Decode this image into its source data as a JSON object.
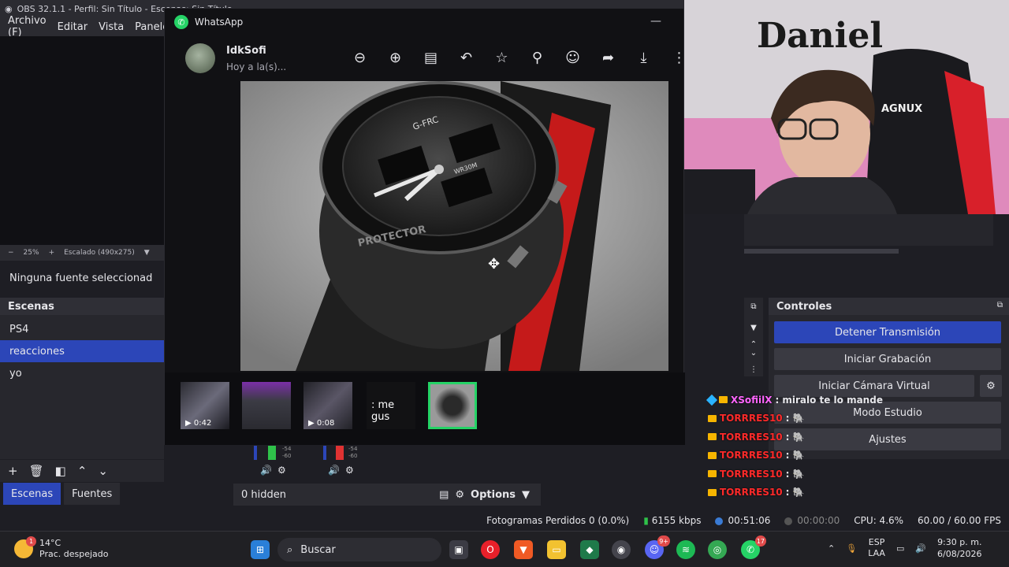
{
  "obs": {
    "title": "OBS 32.1.1 - Perfil: Sin Título - Escenas: Sin Título",
    "menu": [
      "Archivo (F)",
      "Editar",
      "Vista",
      "Panele"
    ],
    "zoom": {
      "level": "25%",
      "scaling": "Escalado (490x275)"
    },
    "no_source": "Ninguna fuente seleccionad",
    "scenes": {
      "header": "Escenas",
      "items": [
        "PS4",
        "reacciones",
        "yo"
      ],
      "selected": "reacciones"
    },
    "dock_tabs": [
      "Escenas",
      "Fuentes"
    ],
    "mixer": {
      "hidden_label": "0 hidden",
      "options_label": "Options"
    },
    "controls": {
      "header": "Controles",
      "buttons": [
        "Detener Transmisión",
        "Iniciar Grabación",
        "Iniciar Cámara Virtual",
        "Modo Estudio",
        "Ajustes"
      ]
    },
    "status": {
      "dropped": "Fotogramas Perdidos 0 (0.0%)",
      "bitrate": "6155 kbps",
      "stream_time": "00:51:06",
      "rec_time": "00:00:00",
      "cpu": "CPU: 4.6%",
      "fps": "60.00 / 60.00 FPS"
    }
  },
  "whatsapp": {
    "window_title": "WhatsApp",
    "contact_name": "IdkSofi",
    "timestamp": "Hoy a la(s)...",
    "thumbnails": [
      {
        "label": "0:42"
      },
      {
        "label": ""
      },
      {
        "label": "0:08"
      },
      {
        "label": ": me gus"
      },
      {
        "label": ""
      }
    ],
    "image_text": {
      "brand": "G-FRC",
      "depth": "WR30M",
      "bezel": "PROTECTOR"
    },
    "tool_icons": [
      "zoom-out-icon",
      "zoom-in-icon",
      "caption-icon",
      "reply-icon",
      "star-icon",
      "pin-icon",
      "react-icon",
      "forward-icon",
      "download-icon",
      "more-icon"
    ]
  },
  "webcam": {
    "wall_text": "Daniel",
    "chair_text": "AGNUX"
  },
  "chat": [
    {
      "user": "XSofiilX",
      "message": "miralo te lo mande",
      "color": "#ff66ff"
    },
    {
      "user": "TORRRES10",
      "message": "",
      "color": "#ff2a2a"
    },
    {
      "user": "TORRRES10",
      "message": "",
      "color": "#ff2a2a"
    },
    {
      "user": "TORRRES10",
      "message": "",
      "color": "#ff2a2a"
    },
    {
      "user": "TORRRES10",
      "message": "",
      "color": "#ff2a2a"
    },
    {
      "user": "TORRRES10",
      "message": "",
      "color": "#ff2a2a"
    }
  ],
  "taskbar": {
    "weather": {
      "temp": "14°C",
      "desc": "Prac. despejado",
      "badge": "1"
    },
    "search_placeholder": "Buscar",
    "badges": {
      "discord": "9+",
      "whatsapp": "17"
    },
    "lang": "ESP",
    "layout": "LAA",
    "time": "9:30 p. m.",
    "date": "6/08/2026"
  },
  "colors": {
    "accent": "#2c46b8",
    "whatsapp_green": "#25d366"
  }
}
